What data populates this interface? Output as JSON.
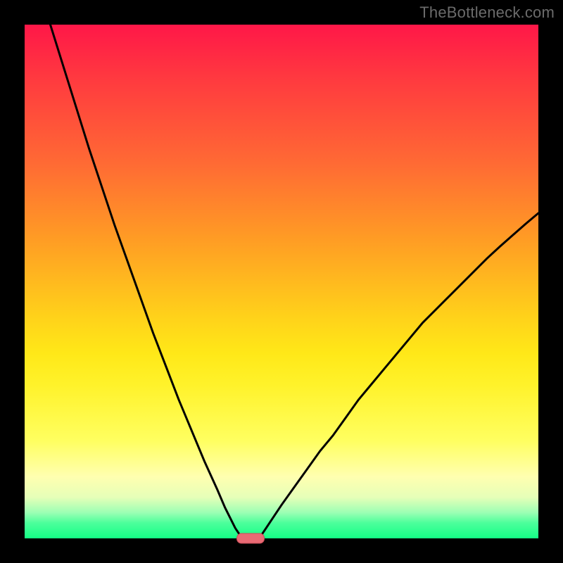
{
  "watermark": "TheBottleneck.com",
  "chart_data": {
    "type": "line",
    "title": "",
    "xlabel": "",
    "ylabel": "",
    "xlim": [
      0,
      100
    ],
    "ylim": [
      0,
      100
    ],
    "grid": false,
    "legend": false,
    "series": [
      {
        "name": "left-branch",
        "x": [
          5,
          7.5,
          10,
          12.5,
          15,
          17.5,
          20,
          22.5,
          25,
          27.5,
          30,
          32.5,
          35,
          37.5,
          39,
          40,
          41,
          42
        ],
        "values": [
          100,
          92,
          84,
          76,
          68.5,
          61,
          54,
          47,
          40,
          33.5,
          27,
          21,
          15,
          9.5,
          6,
          4,
          2,
          0.5
        ]
      },
      {
        "name": "right-branch",
        "x": [
          46,
          47,
          48,
          50,
          52.5,
          55,
          57.5,
          60,
          62.5,
          65,
          67.5,
          70,
          72.5,
          75,
          77.5,
          80,
          82.5,
          85,
          87.5,
          90,
          92.5,
          95,
          97.5,
          100
        ],
        "values": [
          0.5,
          2,
          3.5,
          6.5,
          10,
          13.5,
          17,
          20,
          23.5,
          27,
          30,
          33,
          36,
          39,
          42,
          44.5,
          47,
          49.5,
          52,
          54.5,
          56.8,
          59,
          61.2,
          63.3
        ]
      }
    ],
    "marker": {
      "x": 44,
      "y": 0,
      "width_pct": 5.2
    },
    "background_gradient": {
      "stops": [
        {
          "pos": 0,
          "color": "#ff1748"
        },
        {
          "pos": 11,
          "color": "#ff3b3f"
        },
        {
          "pos": 27,
          "color": "#ff6a34"
        },
        {
          "pos": 42,
          "color": "#ff9d24"
        },
        {
          "pos": 57,
          "color": "#ffd21a"
        },
        {
          "pos": 64,
          "color": "#ffe818"
        },
        {
          "pos": 70,
          "color": "#fff22a"
        },
        {
          "pos": 81,
          "color": "#ffff60"
        },
        {
          "pos": 88,
          "color": "#ffffb0"
        },
        {
          "pos": 92,
          "color": "#e6ffb8"
        },
        {
          "pos": 95,
          "color": "#9bffb4"
        },
        {
          "pos": 97,
          "color": "#4cff9b"
        },
        {
          "pos": 100,
          "color": "#14ff86"
        }
      ]
    }
  }
}
